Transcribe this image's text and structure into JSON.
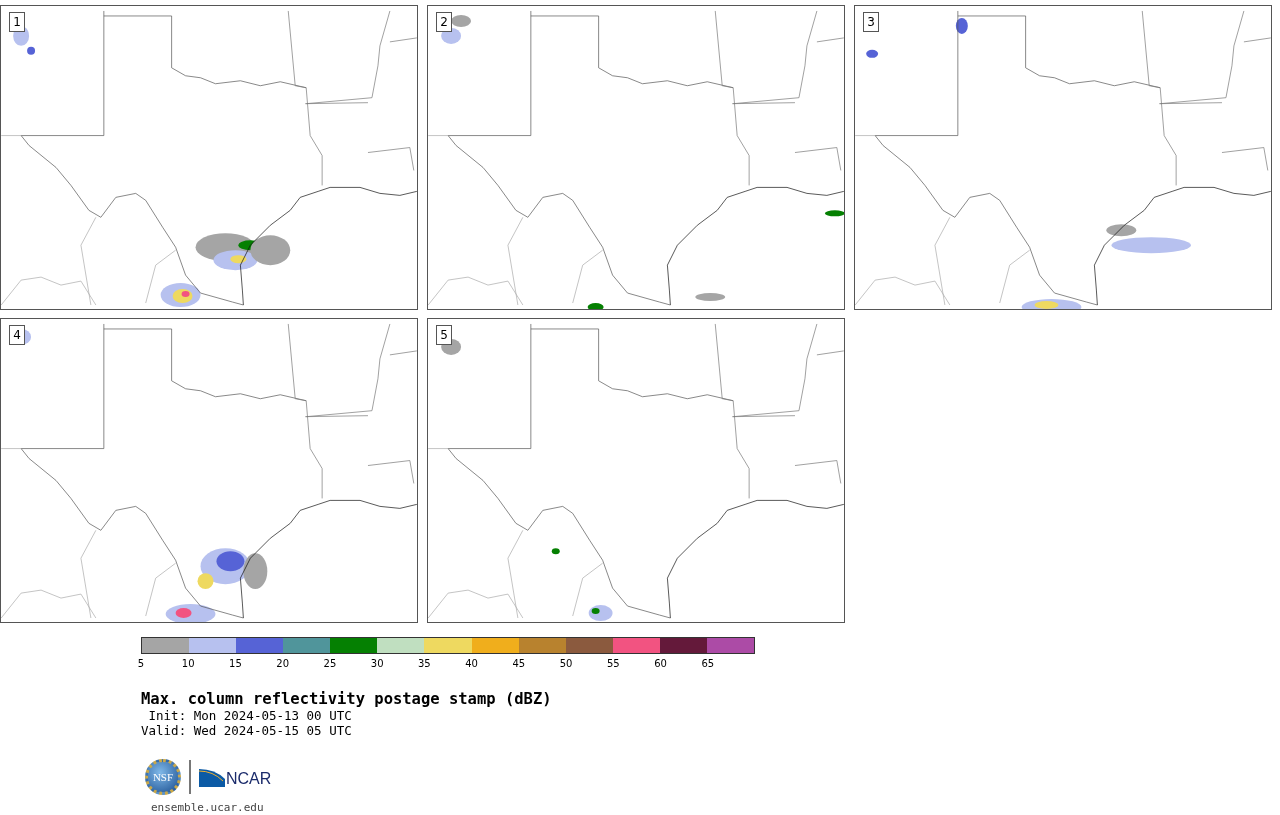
{
  "panels": [
    {
      "label": "1"
    },
    {
      "label": "2"
    },
    {
      "label": "3"
    },
    {
      "label": "4"
    },
    {
      "label": "5"
    }
  ],
  "colorbar": {
    "bins": [
      {
        "color": "#a5a5a5",
        "tick": "5"
      },
      {
        "color": "#b7c1ef",
        "tick": "10"
      },
      {
        "color": "#5663d6",
        "tick": "15"
      },
      {
        "color": "#50959b",
        "tick": "20"
      },
      {
        "color": "#058002",
        "tick": "25"
      },
      {
        "color": "#c0dfc0",
        "tick": "30"
      },
      {
        "color": "#eed960",
        "tick": "35"
      },
      {
        "color": "#f0ae1c",
        "tick": "40"
      },
      {
        "color": "#b8822e",
        "tick": "45"
      },
      {
        "color": "#8b5a3e",
        "tick": "50"
      },
      {
        "color": "#f25381",
        "tick": "55"
      },
      {
        "color": "#64193a",
        "tick": "60"
      },
      {
        "color": "#ac4ba6",
        "tick": "65"
      }
    ]
  },
  "title": "Max. column reflectivity postage stamp (dBZ)",
  "init": " Init: Mon 2024-05-13 00 UTC",
  "valid": "Valid: Wed 2024-05-15 05 UTC",
  "logos": {
    "nsf": "NSF",
    "ncar": "NCAR"
  },
  "url": "ensemble.ucar.edu"
}
